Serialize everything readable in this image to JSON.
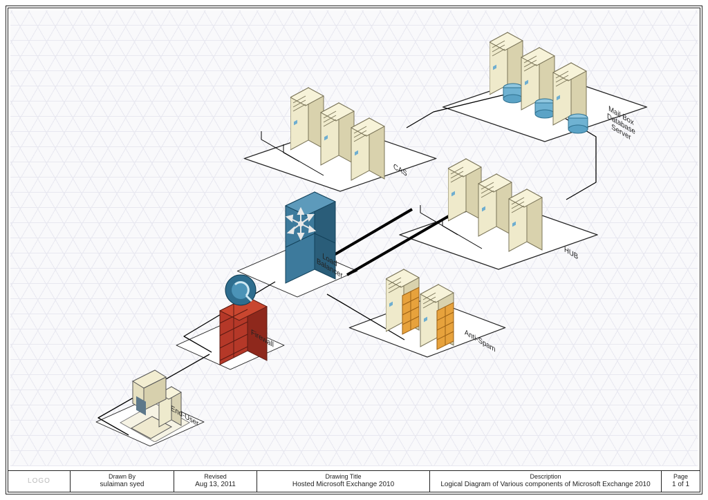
{
  "titleblock": {
    "logo": "LOGO",
    "drawn_by_k": "Drawn By",
    "drawn_by_v": "sulaiman syed",
    "revised_k": "Revised",
    "revised_v": "Aug 13, 2011",
    "drawing_k": "Drawing Title",
    "drawing_v": "Hosted Microsoft Exchange 2010",
    "desc_k": "Description",
    "desc_v": "Logical Diagram of Various components of Microsoft Exchange 2010",
    "page_k": "Page",
    "page_v": "1 of 1"
  },
  "labels": {
    "enduser": "End-User",
    "firewall": "Firewall",
    "lb": "Load\nBalancer",
    "cas": "CAS",
    "hub": "HUB",
    "antispam": "Anti-Spam",
    "mbx": "Mail Box\nDatabase\nServer"
  },
  "nodes": {
    "enduser": {
      "type": "workstation",
      "count": 1
    },
    "firewall": {
      "type": "firewall",
      "count": 1
    },
    "lb": {
      "type": "loadbalancer",
      "count": 1
    },
    "cas": {
      "type": "server",
      "count": 3
    },
    "hub": {
      "type": "server",
      "count": 3
    },
    "antispam": {
      "type": "server-shield",
      "count": 2
    },
    "mbx": {
      "type": "server-db",
      "count": 3
    }
  },
  "connections_desc": "End-User → Firewall → Load Balancer → {CAS, HUB, Anti-Spam}; CAS ↔ Mailbox DB; HUB ↔ Mailbox DB"
}
